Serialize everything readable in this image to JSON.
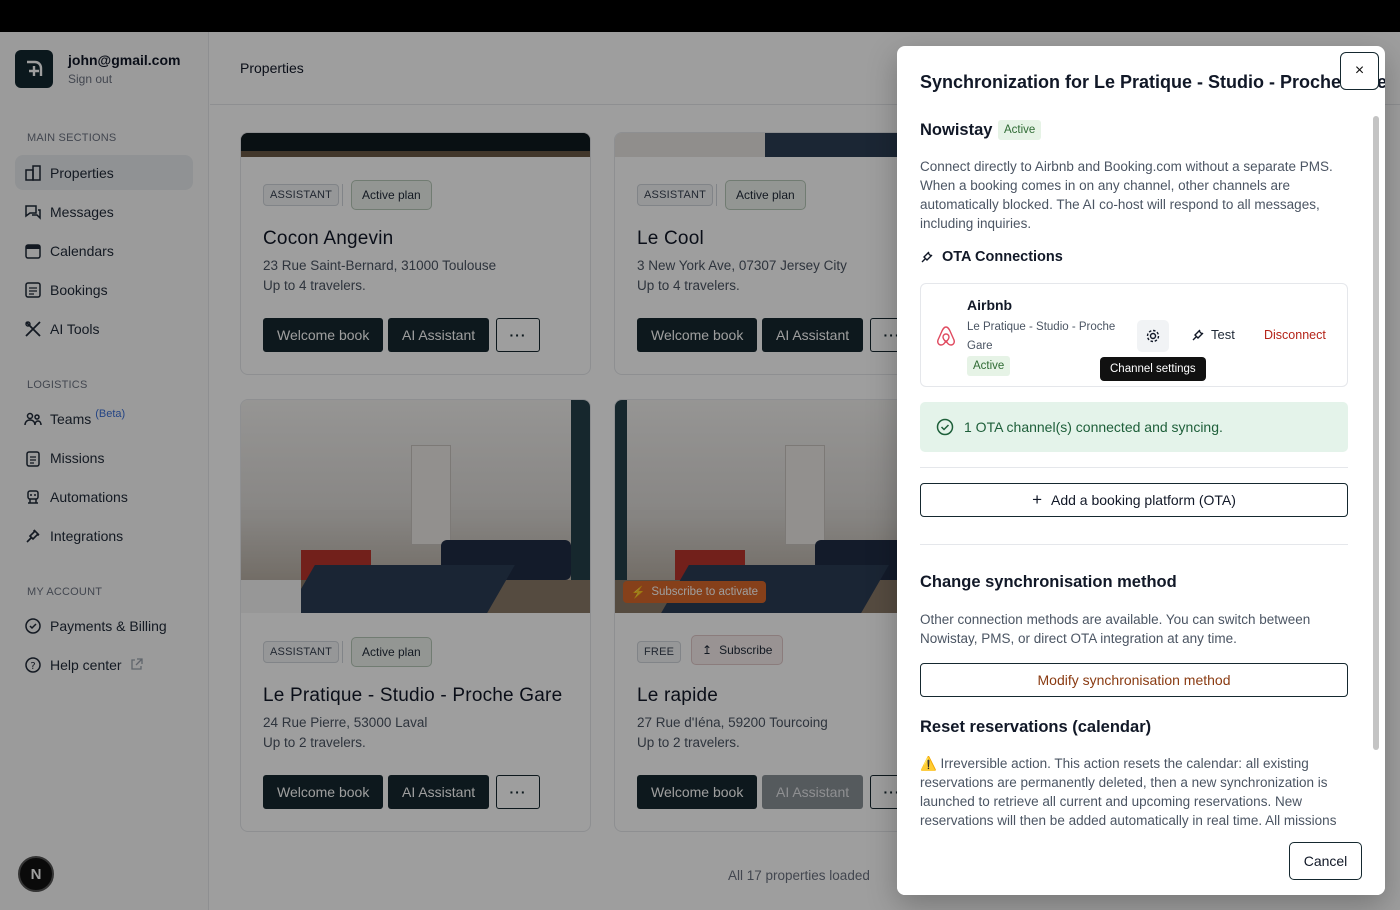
{
  "user": {
    "email": "john@gmail.com",
    "signout": "Sign out"
  },
  "sidebar": {
    "main_title": "MAIN SECTIONS",
    "main_items": [
      {
        "label": "Properties",
        "icon": "building-icon"
      },
      {
        "label": "Messages",
        "icon": "chat-icon"
      },
      {
        "label": "Calendars",
        "icon": "calendar-icon"
      },
      {
        "label": "Bookings",
        "icon": "list-icon"
      },
      {
        "label": "AI Tools",
        "icon": "tools-icon"
      }
    ],
    "logistics_title": "LOGISTICS",
    "logistics_items": [
      {
        "label": "Teams",
        "icon": "users-icon",
        "badge": "(Beta)"
      },
      {
        "label": "Missions",
        "icon": "clipboard-icon"
      },
      {
        "label": "Automations",
        "icon": "robot-icon"
      },
      {
        "label": "Integrations",
        "icon": "plug-icon"
      }
    ],
    "account_title": "MY ACCOUNT",
    "account_items": [
      {
        "label": "Payments & Billing",
        "icon": "billing-icon"
      },
      {
        "label": "Help center",
        "icon": "help-icon"
      }
    ],
    "avatar_letter": "N"
  },
  "page": {
    "title": "Properties",
    "loaded": "All 17 properties loaded"
  },
  "cards": [
    {
      "tag": "ASSISTANT",
      "plan": "Active plan",
      "title": "Cocon Angevin",
      "address": "23 Rue Saint-Bernard, 31000 Toulouse",
      "capacity": "Up to 4 travelers.",
      "btn_welcome": "Welcome book",
      "btn_ai": "AI Assistant",
      "btn_more": "···"
    },
    {
      "tag": "ASSISTANT",
      "plan": "Active plan",
      "title": "Le Cool",
      "address": "3 New York Ave, 07307 Jersey City",
      "capacity": "Up to 4 travelers.",
      "btn_welcome": "Welcome book",
      "btn_ai": "AI Assistant",
      "btn_more": "···"
    },
    {
      "tag": "ASSISTANT",
      "plan": "Active plan",
      "title": "Le Pratique - Studio - Proche Gare",
      "address": "24 Rue Pierre, 53000 Laval",
      "capacity": "Up to 2 travelers.",
      "btn_welcome": "Welcome book",
      "btn_ai": "AI Assistant",
      "btn_more": "···"
    },
    {
      "tag": "FREE",
      "plan": "Subscribe",
      "title": "Le rapide",
      "address": "27 Rue d'Iéna, 59200 Tourcoing",
      "capacity": "Up to 2 travelers.",
      "btn_welcome": "Welcome book",
      "btn_ai": "AI Assistant",
      "btn_more": "···",
      "photo_badge": "Subscribe to activate"
    }
  ],
  "drawer": {
    "title": "Synchronization for Le Pratique - Studio - Proche Gare",
    "close": "×",
    "provider": "Nowistay",
    "provider_status": "Active",
    "intro": "Connect directly to Airbnb and Booking.com without a separate PMS. When a booking comes in on any channel, other channels are automatically blocked. The AI co-host will respond to all messages, including inquiries.",
    "ota_heading": "OTA Connections",
    "ota": {
      "name": "Airbnb",
      "property": "Le Pratique - Studio - Proche Gare",
      "status": "Active",
      "test": "Test",
      "disconnect": "Disconnect",
      "tooltip": "Channel settings"
    },
    "success": "1 OTA channel(s) connected and syncing.",
    "add_ota": "Add a booking platform (OTA)",
    "change_heading": "Change synchronisation method",
    "change_text": "Other connection methods are available. You can switch between Nowistay, PMS, or direct OTA integration at any time.",
    "modify_btn": "Modify synchronisation method",
    "reset_heading": "Reset reservations (calendar)",
    "reset_text": "⚠️ Irreversible action. This action resets the calendar: all existing reservations are permanently deleted, then a new synchronization is launched to retrieve all current and upcoming reservations. New reservations will then be added automatically in real time. All missions",
    "cancel": "Cancel"
  },
  "colors": {
    "brand_dark": "#15282f",
    "success_bg": "#e4f3ea",
    "danger": "#b42318",
    "orange": "#d9682a"
  }
}
